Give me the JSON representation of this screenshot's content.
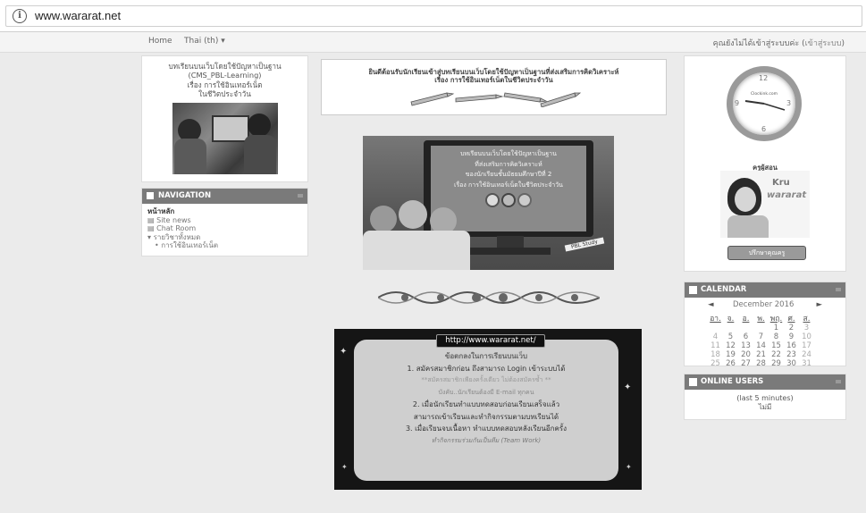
{
  "browser": {
    "url": "www.wararat.net"
  },
  "topnav": {
    "home": "Home",
    "language": "Thai (th) ▾",
    "login_text": "คุณยังไม่ได้เข้าสู่ระบบค่ะ (",
    "login_link": "เข้าสู่ระบบ",
    "login_close": ")"
  },
  "left_course": {
    "title_line1": "บทเรียนบนเว็บโดยใช้ปัญหาเป็นฐาน",
    "title_line2": "(CMS_PBL-Learning)",
    "subtitle_line1": "เรื่อง การใช้อินเทอร์เน็ต",
    "subtitle_line2": "ในชีวิตประจำวัน"
  },
  "navigation": {
    "header": "NAVIGATION",
    "home": "หน้าหลัก",
    "items": [
      "Site news",
      "Chat Room"
    ],
    "all_courses": "รายวิชาทั้งหมด",
    "course": "การใช้อินเทอร์เน็ต"
  },
  "banner": {
    "line1": "ยินดีต้อนรับนักเรียนเข้าสู่บทเรียนบนเว็บโดยใช้ปัญหาเป็นฐานที่ส่งเสริมการคิดวิเคราะห์",
    "line2": "เรื่อง การใช้อินเทอร์เน็ตในชีวิตประจำวัน"
  },
  "monitor": {
    "line1": "บทเรียนบนเว็บโดยใช้ปัญหาเป็นฐาน",
    "line2": "ที่ส่งเสริมการคิดวิเคราะห์",
    "line3": "ของนักเรียนชั้นมัธยมศึกษาปีที่ 2",
    "line4": "เรื่อง การใช้อินเทอร์เน็ตในชีวิตประจำวัน",
    "badge": "PBL Study"
  },
  "rules": {
    "url_label": "http://www.wararat.net/",
    "heading": "ข้อตกลงในการเรียนบนเว็บ",
    "r1": "1. สมัครสมาชิกก่อน ถึงสามารถ Login เข้าระบบได้",
    "r1_note": "**สมัครสมาชิกเพียงครั้งเดียว ไม่ต้องสมัครซ้ำ **",
    "r1_note2": "บังคับ..นักเรียนต้องมี E-mail ทุกคน",
    "r2": "2. เมื่อนักเรียนทำแบบทดสอบก่อนเรียนเสร็จแล้ว",
    "r2b": "สามารถเข้าเรียนและทำกิจกรรมตามบทเรียนได้",
    "r3": "3. เมื่อเรียนจบเนื้อหา ทำแบบทดสอบหลังเรียนอีกครั้ง",
    "r3_note": "ทำกิจกรรมร่วมกันเป็นทีม (Team Work)"
  },
  "clock": {
    "brand": "Clockink.com",
    "n12": "12",
    "n3": "3",
    "n6": "6",
    "n9": "9"
  },
  "teacher": {
    "label": "ครูผู้สอน",
    "logo_line1": "Kru",
    "logo_line2": "wararat",
    "button": "ปรึกษาคุณครู"
  },
  "calendar": {
    "header": "CALENDAR",
    "prev": "◄",
    "next": "►",
    "month": "December 2016",
    "days": [
      "อา.",
      "จ.",
      "อ.",
      "พ.",
      "พฤ.",
      "ศ.",
      "ส."
    ],
    "weeks": [
      [
        "",
        "",
        "",
        "",
        "1",
        "2",
        "3"
      ],
      [
        "4",
        "5",
        "6",
        "7",
        "8",
        "9",
        "10"
      ],
      [
        "11",
        "12",
        "13",
        "14",
        "15",
        "16",
        "17"
      ],
      [
        "18",
        "19",
        "20",
        "21",
        "22",
        "23",
        "24"
      ],
      [
        "25",
        "26",
        "27",
        "28",
        "29",
        "30",
        "31"
      ]
    ]
  },
  "online_users": {
    "header": "ONLINE USERS",
    "line1": "(last 5 minutes)",
    "line2": "ไม่มี"
  }
}
